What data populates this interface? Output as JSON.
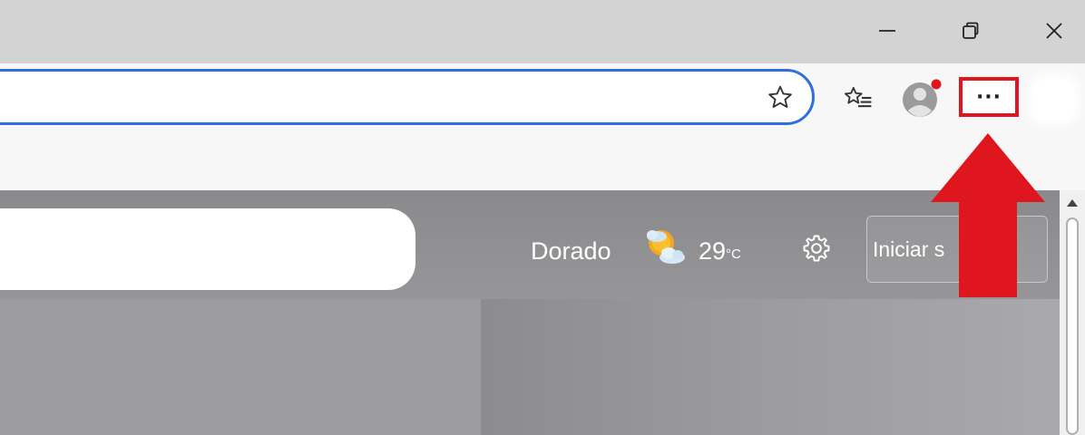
{
  "window_controls": {
    "minimize_icon": "minimize-icon",
    "restore_icon": "restore-icon",
    "close_icon": "close-icon"
  },
  "toolbar": {
    "favorite_icon": "star-outline-icon",
    "favorites_icon": "favorites-list-icon",
    "profile_icon": "profile-avatar-icon",
    "more_label": "···"
  },
  "page": {
    "weather": {
      "city": "Dorado",
      "icon": "partly-cloudy-sun-icon",
      "temperature": "29",
      "unit": "°C"
    },
    "settings_icon": "gear-icon",
    "signin_label": "Iniciar s"
  },
  "annotation": {
    "highlight_color": "#e0161e",
    "arrow_color": "#e0161e"
  },
  "colors": {
    "address_bar_border": "#2f6fde",
    "titlebar": "#d3d3d3",
    "profile_notification": "#e0161e"
  }
}
